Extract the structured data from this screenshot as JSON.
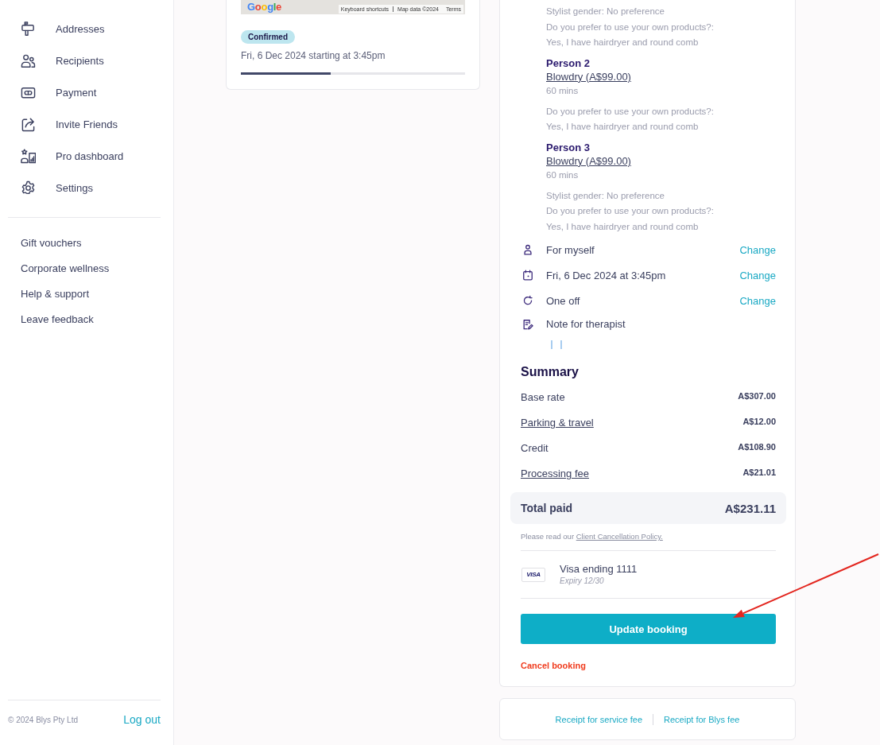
{
  "sidebar": {
    "nav_items": [
      {
        "label": "Addresses"
      },
      {
        "label": "Recipients"
      },
      {
        "label": "Payment"
      },
      {
        "label": "Invite Friends"
      },
      {
        "label": "Pro dashboard"
      },
      {
        "label": "Settings"
      }
    ],
    "links": [
      "Gift vouchers",
      "Corporate wellness",
      "Help & support",
      "Leave feedback"
    ],
    "footer": {
      "copyright": "© 2024 Blys Pty Ltd",
      "logout": "Log out"
    }
  },
  "booking_card": {
    "map": {
      "logo": "Google",
      "attribution": [
        "Keyboard shortcuts",
        "Map data ©2024",
        "Terms"
      ]
    },
    "status": "Confirmed",
    "schedule": "Fri, 6 Dec 2024 starting at 3:45pm",
    "progress": {
      "level": 0.4
    }
  },
  "details_card": {
    "persons": [
      {
        "answers": [
          "Stylist gender: No preference",
          "Do you prefer to use your own products?:",
          "Yes, I have hairdryer and round comb"
        ]
      },
      {
        "name": "Person 2",
        "service": "Blowdry (A$99.00)",
        "duration": "60 mins",
        "answers": [
          "Do you prefer to use your own products?:",
          "Yes, I have hairdryer and round comb"
        ]
      },
      {
        "name": "Person 3",
        "service": "Blowdry (A$99.00)",
        "duration": "60 mins",
        "answers": [
          "Stylist gender: No preference",
          "Do you prefer to use your own products?:",
          "Yes, I have hairdryer and round comb"
        ]
      }
    ],
    "details": [
      {
        "label": "For myself",
        "action": "Change"
      },
      {
        "label": "Fri, 6 Dec 2024 at 3:45pm",
        "action": "Change"
      },
      {
        "label": "One off",
        "action": "Change"
      },
      {
        "label": "Note for therapist"
      }
    ],
    "summary": {
      "title": "Summary",
      "rows": [
        {
          "kind": "text",
          "label": "Base rate",
          "amount": "A$307.00"
        },
        {
          "kind": "link",
          "label": "Parking & travel",
          "amount": "A$12.00"
        },
        {
          "kind": "text",
          "label": "Credit",
          "amount": "A$108.90"
        },
        {
          "kind": "link",
          "label": "Processing fee",
          "amount": "A$21.01"
        }
      ],
      "total": {
        "label": "Total paid",
        "amount": "A$231.11"
      }
    },
    "policy": {
      "text": "Please read our",
      "link": "Client Cancellation Policy."
    },
    "payment_method": {
      "brand": "VISA",
      "title": "Visa ending 1111",
      "expiry": "Expiry 12/30"
    },
    "button": "Update booking",
    "cancel": "Cancel booking"
  },
  "receipts": {
    "links": [
      "Receipt for service fee",
      "Receipt for Blys fee"
    ]
  }
}
